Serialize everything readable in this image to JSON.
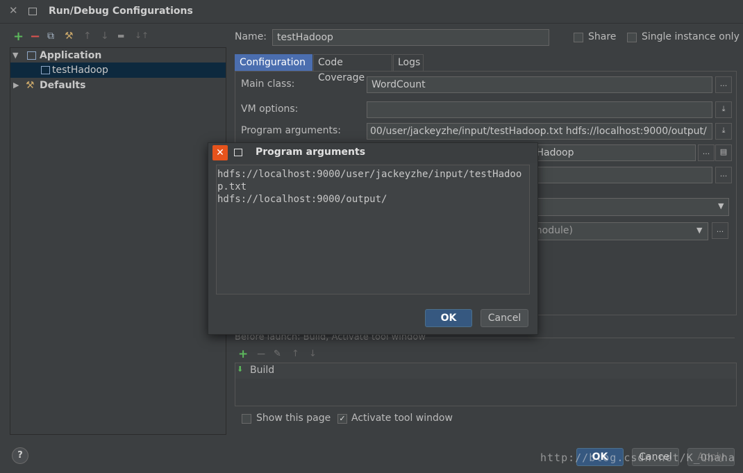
{
  "window": {
    "title": "Run/Debug Configurations"
  },
  "toolbar": {
    "add": "+",
    "remove": "−",
    "copy": "⧉",
    "wrench": "⚒",
    "up": "↑",
    "down": "↓",
    "folder": "▬",
    "sort": "↓↑"
  },
  "tree": {
    "items": [
      {
        "label": "Application",
        "icon": "application-icon",
        "expanded": true
      },
      {
        "label": "testHadoop",
        "icon": "config-icon",
        "selected": true
      },
      {
        "label": "Defaults",
        "icon": "wrench-icon",
        "expanded": false
      }
    ]
  },
  "form": {
    "name_label": "Name:",
    "name_value": "testHadoop",
    "share_label": "Share",
    "single_instance_label": "Single instance only",
    "tabs": [
      {
        "label": "Configuration",
        "active": true
      },
      {
        "label": "Code Coverage",
        "active": false
      },
      {
        "label": "Logs",
        "active": false
      }
    ],
    "main_class_label": "Main class:",
    "main_class_value": "WordCount",
    "vm_options_label": "VM options:",
    "vm_options_value": "",
    "program_args_label": "Program arguments:",
    "program_args_value": "00/user/jackeyzhe/input/testHadoop.txt hdfs://localhost:9000/output/",
    "working_dir_partial": "tHadoop",
    "classpath_partial": "module)",
    "browse": "...",
    "before_launch_label": "Before launch: Build, Activate tool window",
    "build_item": "Build",
    "show_page_label": "Show this page",
    "activate_tool_label": "Activate tool window",
    "show_page_checked": false,
    "activate_tool_checked": true
  },
  "bottom": {
    "ok": "OK",
    "cancel": "Cancel",
    "apply": "Apply",
    "help": "?"
  },
  "modal": {
    "title": "Program arguments",
    "text": "hdfs://localhost:9000/user/jackeyzhe/input/testHadoop.txt\nhdfs://localhost:9000/output/",
    "ok": "OK",
    "cancel": "Cancel"
  },
  "watermark": "http://blog.csdn.net/K_Ohaha",
  "colors": {
    "accent": "#4b6eaf",
    "selection": "#0d293e",
    "close": "#e6531c",
    "add": "#5cb85c",
    "remove": "#d9534f"
  }
}
